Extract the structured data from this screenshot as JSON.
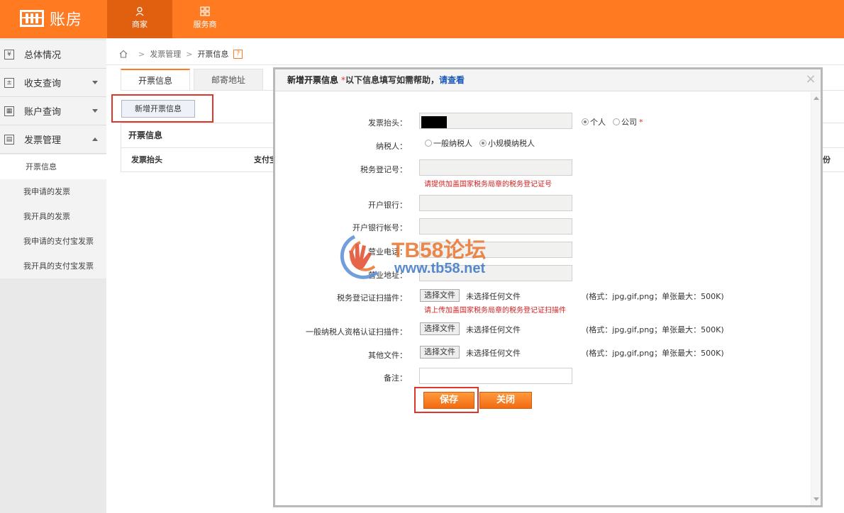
{
  "app": {
    "logo_text": "账房"
  },
  "topnav": [
    {
      "label": "商家",
      "active": true
    },
    {
      "label": "服务商",
      "active": false
    }
  ],
  "sidebar": {
    "items": [
      {
        "label": "总体情况",
        "icon": "yuan-icon",
        "icon_glyph": "¥"
      },
      {
        "label": "收支查询",
        "icon": "plus-minus-icon",
        "icon_glyph": "±"
      },
      {
        "label": "账户查询",
        "icon": "grid-icon",
        "icon_glyph": "▦"
      },
      {
        "label": "发票管理",
        "icon": "invoice-icon",
        "icon_glyph": "▤"
      }
    ],
    "subitems": [
      {
        "label": "开票信息",
        "active": true
      },
      {
        "label": "我申请的发票",
        "active": false
      },
      {
        "label": "我开具的发票",
        "active": false
      },
      {
        "label": "我申请的支付宝发票",
        "active": false
      },
      {
        "label": "我开具的支付宝发票",
        "active": false
      }
    ]
  },
  "breadcrumb": {
    "parent": "发票管理",
    "current": "开票信息",
    "help": "?"
  },
  "tabs": [
    {
      "label": "开票信息",
      "active": true
    },
    {
      "label": "邮寄地址",
      "active": false
    }
  ],
  "add_button": "新增开票信息",
  "panel": {
    "title": "开票信息",
    "columns": [
      "发票抬头",
      "支付宝",
      "份"
    ]
  },
  "modal": {
    "title": "新增开票信息",
    "star": "*",
    "note": "以下信息填写如需帮助，",
    "link": "请查看",
    "close": "×",
    "fields": {
      "invoice_title_label": "发票抬头：",
      "invoice_title_options": [
        "个人",
        "公司"
      ],
      "invoice_title_selected": "个人",
      "taxpayer_label": "纳税人：",
      "taxpayer_options": [
        "一般纳税人",
        "小规模纳税人"
      ],
      "taxpayer_selected": "小规模纳税人",
      "tax_reg_label": "税务登记号：",
      "tax_reg_hint": "请提供加盖国家税务局章的税务登记证号",
      "bank_label": "开户银行：",
      "bank_account_label": "开户银行帐号：",
      "phone_label": "营业电话：",
      "address_label": "营业地址：",
      "tax_cert_label": "税务登记证扫描件：",
      "tax_cert_hint": "请上传加盖国家税务局章的税务登记证扫描件",
      "general_cert_label": "一般纳税人资格认证扫描件：",
      "other_label": "其他文件：",
      "remark_label": "备注："
    },
    "file_button": "选择文件",
    "file_none": "未选择任何文件",
    "file_format": "(格式：jpg,gif,png；单张最大：500K)",
    "save": "保存",
    "close_label": "关闭"
  },
  "watermark": {
    "line1": "TB58论坛",
    "line2": "www.tb58.net"
  }
}
